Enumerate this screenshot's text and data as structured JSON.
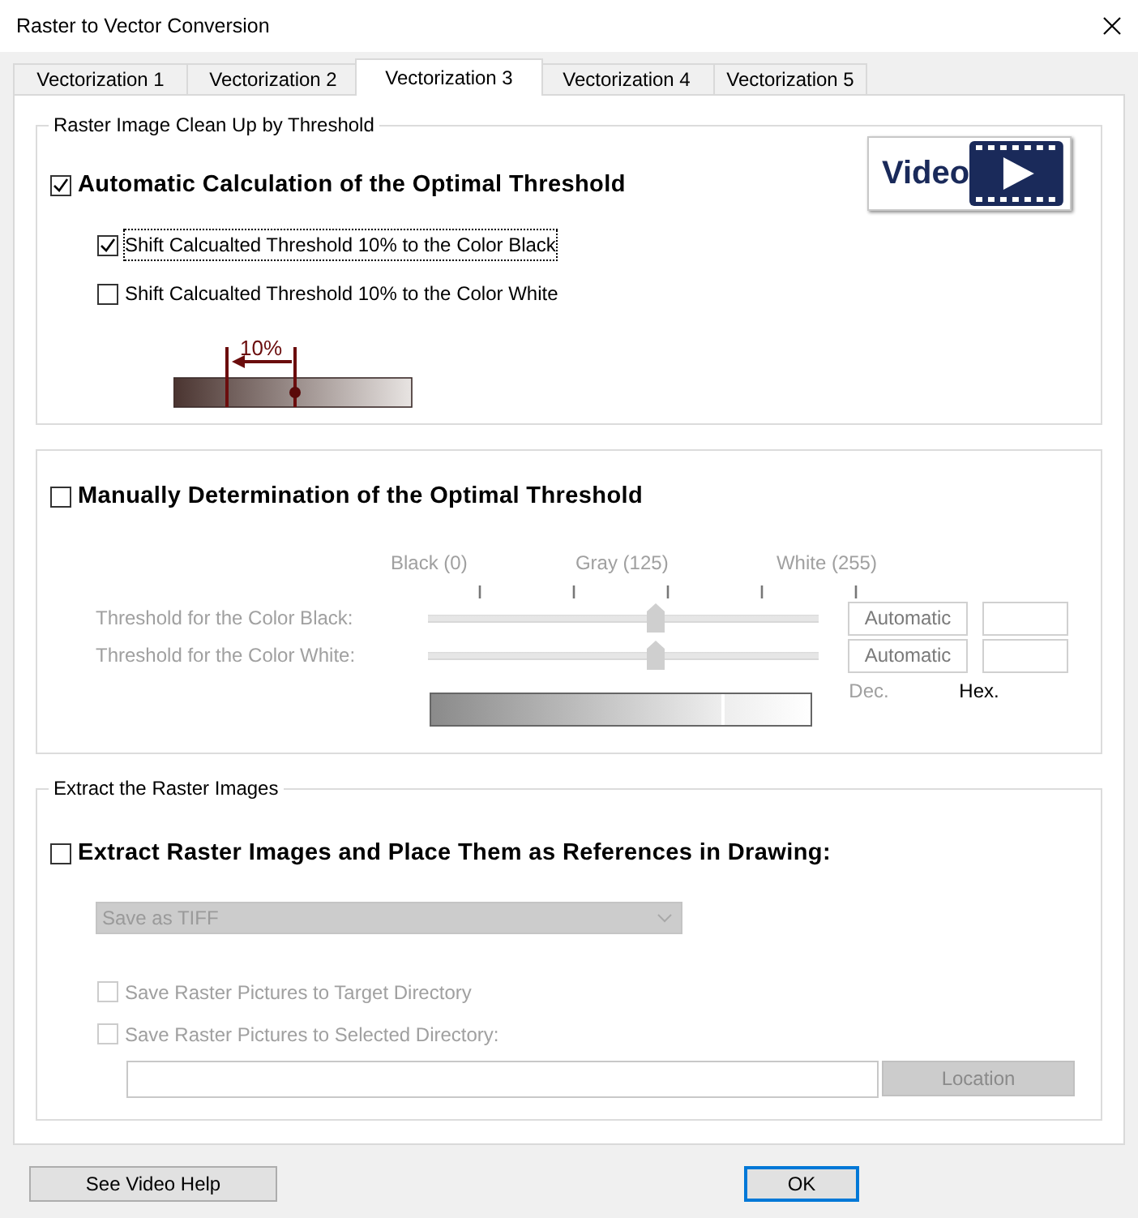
{
  "window": {
    "title": "Raster to Vector Conversion"
  },
  "tabs": [
    {
      "label": "Vectorization 1",
      "selected": false
    },
    {
      "label": "Vectorization 2",
      "selected": false
    },
    {
      "label": "Vectorization 3",
      "selected": true
    },
    {
      "label": "Vectorization 4",
      "selected": false
    },
    {
      "label": "Vectorization 5",
      "selected": false
    }
  ],
  "cleanup": {
    "legend": "Raster Image Clean Up by Threshold",
    "video_button": "Video",
    "auto_option": {
      "label": "Automatic Calculation of the Optimal Threshold",
      "checked": true
    },
    "shift_options": [
      {
        "label": "Shift Calcualted Threshold 10% to the Color Black",
        "checked": true,
        "focused": true
      },
      {
        "label": "Shift Calcualted Threshold 10% to the Color White",
        "checked": false,
        "focused": false
      }
    ],
    "shift_diagram_label": "10%"
  },
  "manual": {
    "option": {
      "label": "Manually Determination of the Optimal Threshold",
      "checked": false
    },
    "scale_labels": [
      "Black (0)",
      "Gray (125)",
      "White (255)"
    ],
    "rows": [
      {
        "label": "Threshold for the Color Black:",
        "level": 0.58,
        "button": "Automatic"
      },
      {
        "label": "Threshold for the Color White:",
        "level": 0.58,
        "button": "Automatic"
      }
    ],
    "column_labels": [
      {
        "text": "Dec.",
        "disabled": true
      },
      {
        "text": "Hex.",
        "disabled": false
      }
    ]
  },
  "extract": {
    "legend": "Extract the Raster Images",
    "option": {
      "label": "Extract Raster Images and Place Them as References in Drawing:",
      "checked": false
    },
    "format_select": {
      "value": "Save as TIFF",
      "disabled": true
    },
    "save_options": [
      {
        "label": "Save Raster Pictures to Target Directory",
        "checked": false,
        "disabled": true
      },
      {
        "label": "Save Raster Pictures to Selected Directory:",
        "checked": false,
        "disabled": true
      }
    ],
    "location_button": {
      "label": "Location",
      "disabled": true
    }
  },
  "footer_buttons": [
    {
      "label": "See Video Help",
      "kind": "plain"
    },
    {
      "label": "OK",
      "kind": "default"
    }
  ]
}
